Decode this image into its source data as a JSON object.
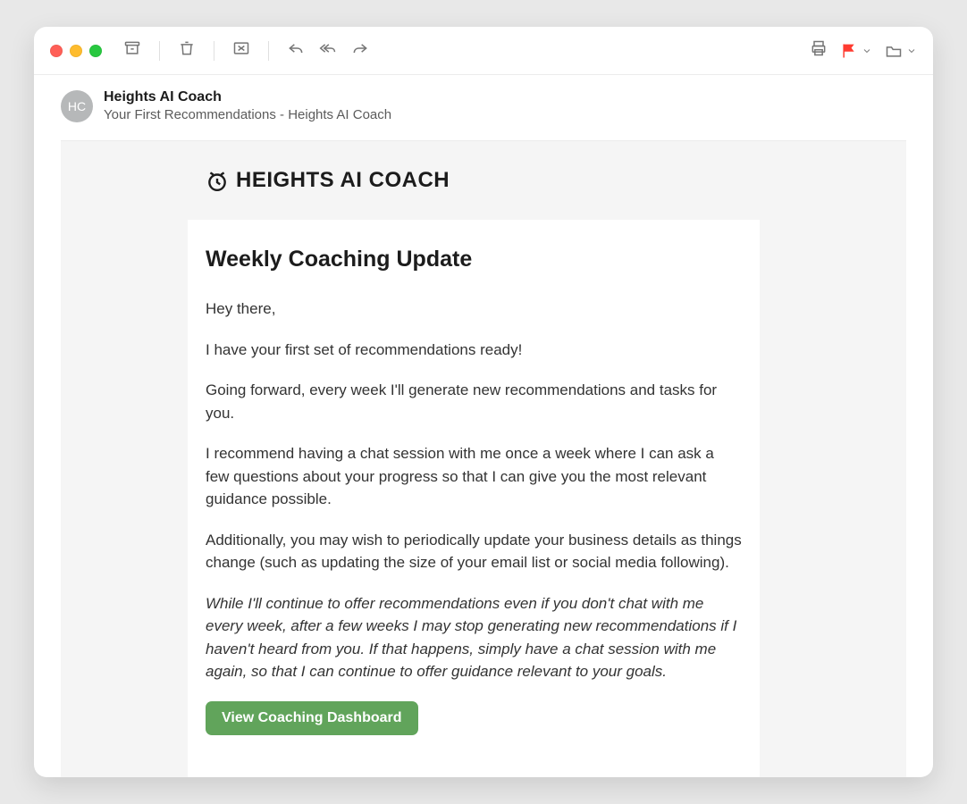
{
  "sender": {
    "avatar_initials": "HC",
    "name": "Heights AI Coach",
    "subject": "Your First Recommendations - Heights AI Coach"
  },
  "brand": {
    "name": "HEIGHTS AI COACH"
  },
  "email": {
    "heading": "Weekly Coaching Update",
    "paragraphs": [
      "Hey there,",
      "I have your first set of recommendations ready!",
      "Going forward, every week I'll generate new recommendations and tasks for you.",
      "I recommend having a chat session with me once a week where I can ask a few questions about your progress so that I can give you the most relevant guidance possible.",
      "Additionally, you may wish to periodically update your business details as things change (such as updating the size of your email list or social media following)."
    ],
    "italic_paragraph": "While I'll continue to offer recommendations even if you don't chat with me every week, after a few weeks I may stop generating new recommendations if I haven't heard from you. If that happens, simply have a chat session with me again, so that I can continue to offer guidance relevant to your goals.",
    "cta_label": "View Coaching Dashboard"
  }
}
